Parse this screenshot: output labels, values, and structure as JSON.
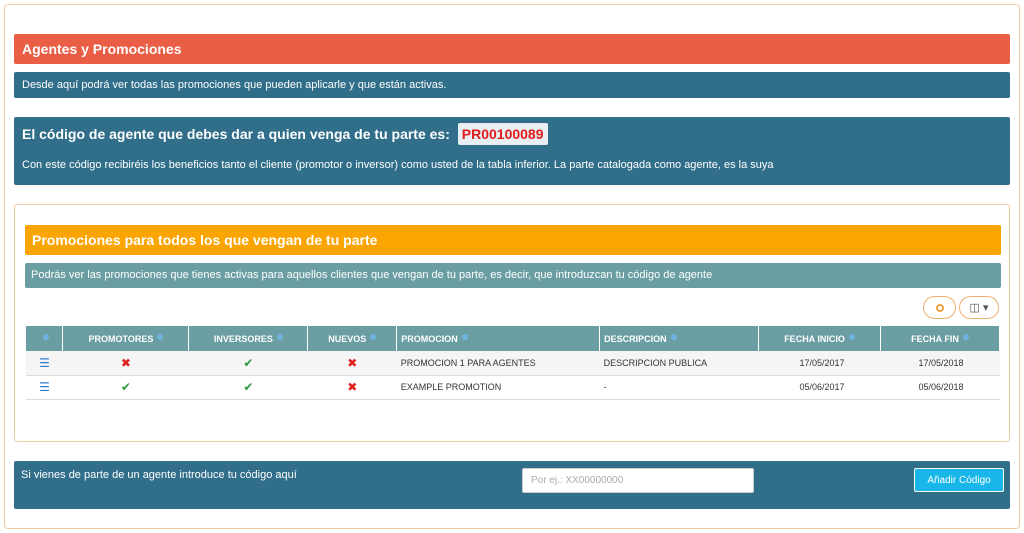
{
  "header": {
    "title": "Agentes y Promociones",
    "info": "Desde aquí podrá ver todas las promociones que pueden aplicarle y que están activas."
  },
  "agent": {
    "title": "El código de agente que debes dar a quien venga de tu parte es:",
    "code": "PR00100089",
    "description": "Con este código recibiréis los beneficios tanto el cliente (promotor o inversor) como usted de la tabla inferior. La parte catalogada como agente, es la suya"
  },
  "promotions": {
    "title": "Promociones para todos los que vengan de tu parte",
    "info": "Podrás ver las promociones que tienes activas para aquellos clientes que vengan de tu parte, es decir, que introduzcan tu código de agente",
    "columns": [
      "",
      "PROMOTORES",
      "INVERSORES",
      "NUEVOS",
      "PROMOCION",
      "DESCRIPCION",
      "FECHA INICIO",
      "FECHA FIN"
    ],
    "rows": [
      {
        "promotores": "✖",
        "inversores": "✔",
        "nuevos": "✖",
        "promocion": "PROMOCION 1 PARA AGENTES",
        "descripcion": "DESCRIPCION PUBLICA",
        "fecha_inicio": "17/05/2017",
        "fecha_fin": "17/05/2018"
      },
      {
        "promotores": "✔",
        "inversores": "✔",
        "nuevos": "✖",
        "promocion": "EXAMPLE PROMOTION",
        "descripcion": "-",
        "fecha_inicio": "05/06/2017",
        "fecha_fin": "05/06/2018"
      }
    ]
  },
  "bottom": {
    "label": "Si vienes de parte de un agente introduce tu código aquí",
    "placeholder": "Por ej.: XX00000000",
    "button": "Añadir Código"
  },
  "colors": {
    "red_header": "#e95e45",
    "blue_panel": "#306e8a",
    "orange_header": "#fba502",
    "teal": "#6a9ea3",
    "button_cyan": "#19b6ea"
  }
}
